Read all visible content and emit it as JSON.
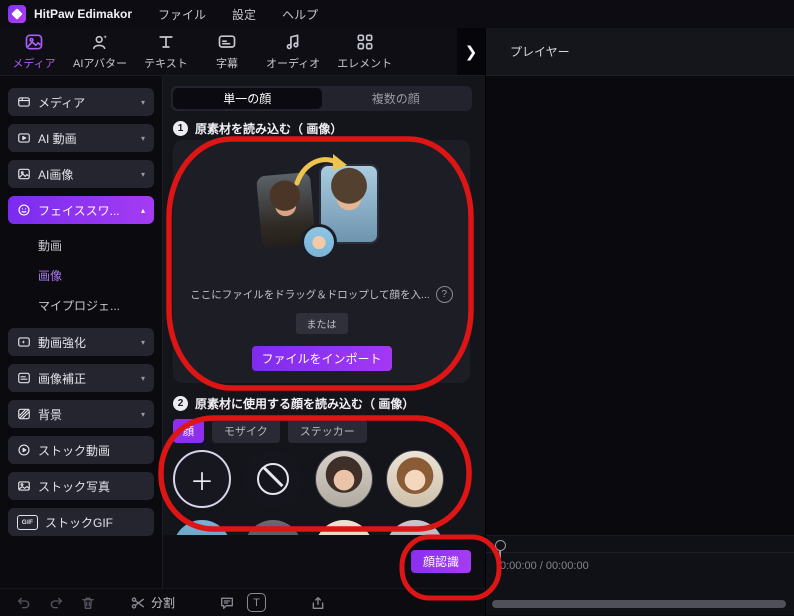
{
  "titlebar": {
    "app_title": "HitPaw Edimakor",
    "menu_file": "ファイル",
    "menu_settings": "設定",
    "menu_help": "ヘルプ"
  },
  "tabbar": {
    "tabs": [
      {
        "label": "メディア"
      },
      {
        "label": "AIアバター"
      },
      {
        "label": "テキスト"
      },
      {
        "label": "字幕"
      },
      {
        "label": "オーディオ"
      },
      {
        "label": "エレメント"
      }
    ]
  },
  "sidebar": {
    "items": [
      {
        "label": "メディア"
      },
      {
        "label": "AI 動画"
      },
      {
        "label": "AI画像"
      },
      {
        "label": "フェイススワ..."
      },
      {
        "label": "動画強化"
      },
      {
        "label": "画像補正"
      },
      {
        "label": "背景"
      },
      {
        "label": "ストック動画"
      },
      {
        "label": "ストック写真"
      },
      {
        "label": "ストックGIF"
      }
    ],
    "faceswap_sub": [
      {
        "label": "動画"
      },
      {
        "label": "画像"
      },
      {
        "label": "マイプロジェ..."
      }
    ]
  },
  "main": {
    "mode_tabs": [
      {
        "label": "単一の顔"
      },
      {
        "label": "複数の顔"
      }
    ],
    "step1": {
      "number": "1",
      "title": "原素材を読み込む（ 画像）"
    },
    "dropzone": {
      "hint": "ここにファイルをドラッグ＆ドロップして顔を入...",
      "or_label": "または",
      "import_button": "ファイルをインポート"
    },
    "step2": {
      "number": "2",
      "title": "原素材に使用する顔を読み込む（ 画像）"
    },
    "category_tabs": [
      {
        "label": "顔"
      },
      {
        "label": "モザイク"
      },
      {
        "label": "ステッカー"
      }
    ],
    "face_recognition_button": "顔認識"
  },
  "player": {
    "title": "プレイヤー",
    "time": "0:00:00 / 00:00:00"
  },
  "toolbar": {
    "split_label": "分割"
  },
  "icons": {
    "chevron_down": "▾",
    "chevron_up": "▴",
    "more_arrow": "❯",
    "plus": "＋",
    "help": "?",
    "text_tool": "T",
    "gif_label": "GIF"
  },
  "colors": {
    "accent_purple": "#8e2ff0",
    "annotation_red": "#dd1515"
  }
}
